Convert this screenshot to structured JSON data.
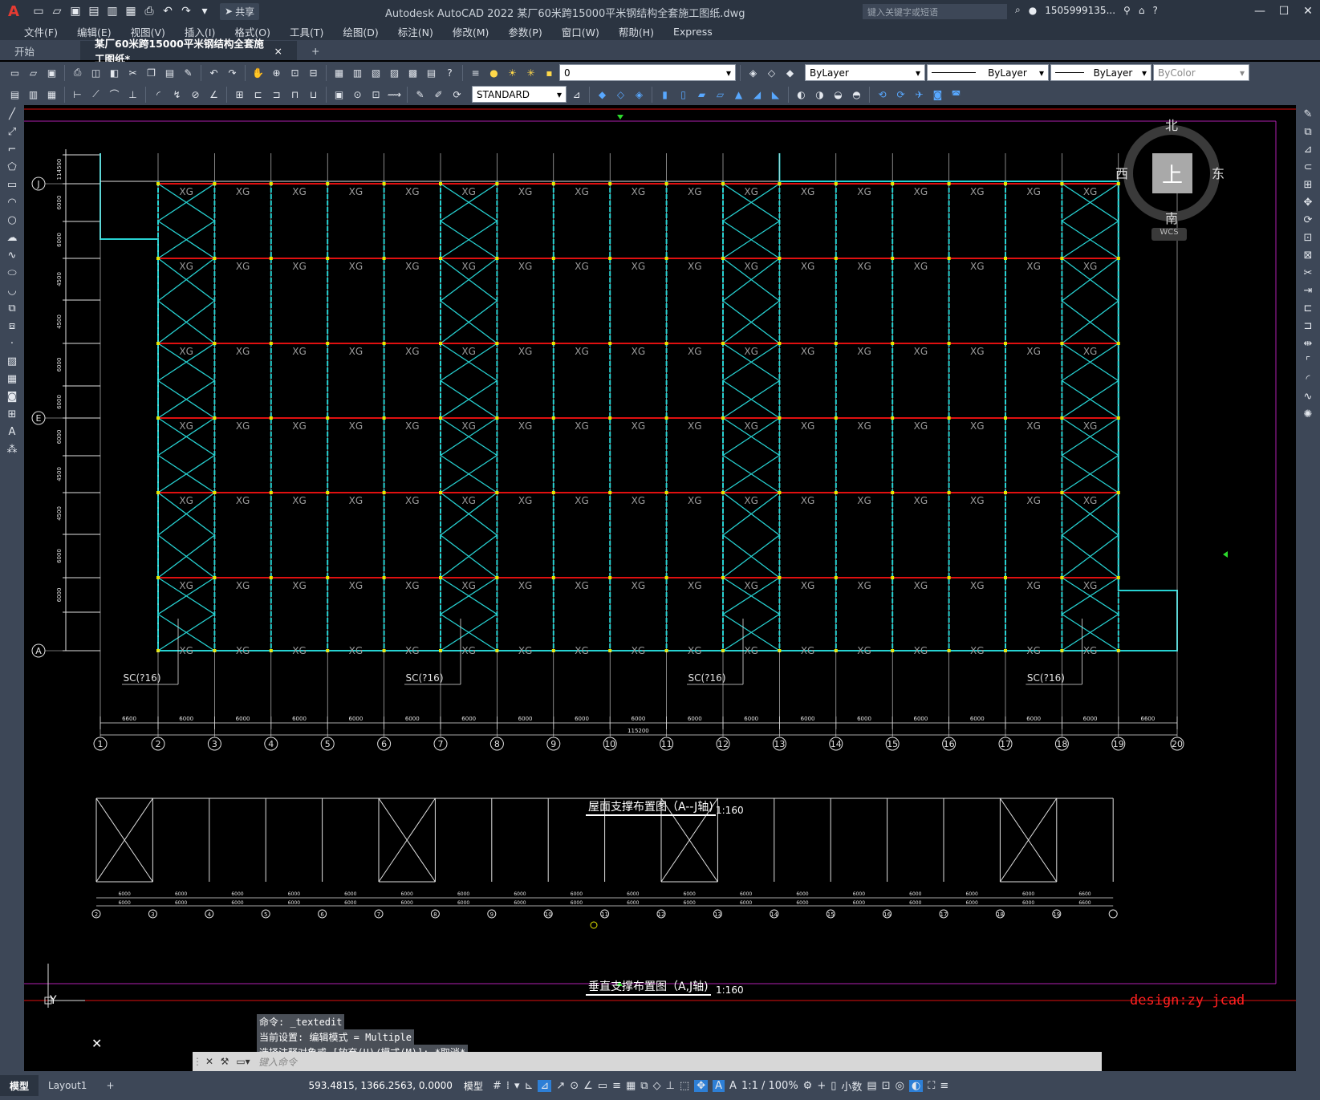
{
  "app": {
    "logo": "A",
    "title": "Autodesk AutoCAD 2022    某厂60米跨15000平米钢结构全套施工图纸.dwg",
    "share_label": "共享",
    "search_placeholder": "键入关键字或短语",
    "user_name": "1505999135...",
    "help": "?"
  },
  "menu": [
    "文件(F)",
    "编辑(E)",
    "视图(V)",
    "插入(I)",
    "格式(O)",
    "工具(T)",
    "绘图(D)",
    "标注(N)",
    "修改(M)",
    "参数(P)",
    "窗口(W)",
    "帮助(H)",
    "Express"
  ],
  "tabs": [
    {
      "label": "开始"
    },
    {
      "label": "某厂60米跨15000平米钢结构全套施工图纸*",
      "close": "×"
    },
    {
      "label": "+"
    }
  ],
  "toolbar": {
    "layer_value": "0",
    "style_value": "STANDARD",
    "color_value": "ByLayer",
    "linetype_value": "ByLayer",
    "lineweight_value": "ByLayer",
    "plotstyle_value": "ByColor"
  },
  "viewcube": {
    "north": "北",
    "south": "南",
    "east": "东",
    "west": "西",
    "top": "上",
    "wcs": "WCS"
  },
  "drawing": {
    "plan_title": "屋面支撑布置图（A--J轴)",
    "plan_scale": "1:160",
    "elev_title": "垂直支撑布置图（A,J轴)",
    "elev_scale": "1:160",
    "member_label": "XG",
    "brace_label": "SC(?16)",
    "total_dim": "115200",
    "grid_axes": [
      "1",
      "2",
      "3",
      "4",
      "5",
      "6",
      "7",
      "8",
      "9",
      "10",
      "11",
      "12",
      "13",
      "14",
      "15",
      "16",
      "17",
      "18",
      "19",
      "20"
    ],
    "row_axes": [
      "J",
      "E",
      "A"
    ],
    "dims_top": [
      "6600",
      "6000",
      "6000",
      "6000",
      "6000",
      "6000",
      "6000",
      "6000",
      "6000",
      "6000",
      "6000",
      "6000",
      "6000",
      "6000",
      "6000",
      "6000",
      "6000",
      "6000",
      "6600"
    ],
    "left_dims": [
      "114500",
      "6000",
      "6000",
      "4500",
      "4500",
      "6000",
      "6000",
      "6000",
      "4500",
      "4500",
      "6000",
      "6000"
    ],
    "elev_axes": [
      "2",
      "3",
      "4",
      "5",
      "6",
      "7",
      "8",
      "9",
      "10",
      "11",
      "12",
      "13",
      "14",
      "15",
      "16",
      "17",
      "18",
      "19"
    ],
    "designer": "design:zy jcad"
  },
  "command": {
    "history": [
      "命令: _textedit",
      "当前设置: 编辑模式 = Multiple",
      "选择注释对象或 [放弃(U)/模式(M)]: *取消*"
    ],
    "placeholder": "键入命令"
  },
  "status": {
    "model_tab": "模型",
    "layout_tab": "Layout1",
    "add_tab": "+",
    "coords": "593.4815, 1366.2563, 0.0000",
    "space": "模型",
    "scale": "1:1 / 100%",
    "units": "小数"
  },
  "colors": {
    "cyan": "#27d2d2",
    "red": "#e01010",
    "yellow": "#e6e600",
    "magenta": "#b020b0",
    "white": "#e0e0e0"
  }
}
